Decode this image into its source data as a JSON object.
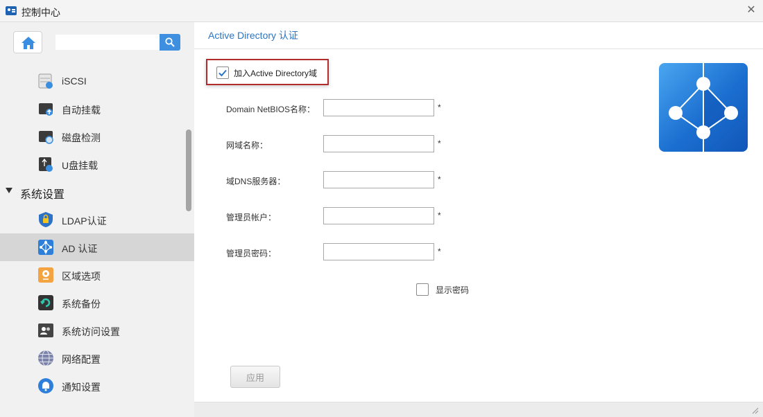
{
  "window": {
    "title": "控制中心"
  },
  "sidebar": {
    "search": {
      "value": "",
      "placeholder": ""
    },
    "items": [
      {
        "label": "iSCSI",
        "icon": "iscsi-icon"
      },
      {
        "label": "自动挂载",
        "icon": "auto-mount-icon"
      },
      {
        "label": "磁盘检测",
        "icon": "disk-check-icon"
      },
      {
        "label": "U盘挂载",
        "icon": "usb-mount-icon"
      }
    ],
    "section": {
      "label": "系统设置"
    },
    "section_items": [
      {
        "label": "LDAP认证",
        "icon": "ldap-lock-icon"
      },
      {
        "label": "AD 认证",
        "icon": "ad-icon",
        "active": true
      },
      {
        "label": "区域选项",
        "icon": "region-icon"
      },
      {
        "label": "系统备份",
        "icon": "backup-icon"
      },
      {
        "label": "系统访问设置",
        "icon": "access-icon"
      },
      {
        "label": "网络配置",
        "icon": "network-icon"
      },
      {
        "label": "通知设置",
        "icon": "notification-icon"
      }
    ]
  },
  "main": {
    "title": "Active Directory 认证",
    "join": {
      "label": "加入Active Directory域",
      "checked": true
    },
    "fields": [
      {
        "label": "Domain NetBIOS名称：",
        "value": "",
        "required": "*"
      },
      {
        "label": "网域名称：",
        "value": "",
        "required": "*"
      },
      {
        "label": "域DNS服务器：",
        "value": "",
        "required": "*"
      },
      {
        "label": "管理员帐户：",
        "value": "",
        "required": "*"
      },
      {
        "label": "管理员密码：",
        "value": "",
        "required": "*"
      }
    ],
    "show_password": {
      "label": "显示密码",
      "checked": false
    },
    "apply_label": "应用"
  },
  "colors": {
    "accent": "#2a74c4",
    "search_button": "#3f8fe0",
    "highlight_border": "#b32b2b",
    "active_item": "#d6d6d6",
    "ad_logo": "#1b6fd0"
  }
}
